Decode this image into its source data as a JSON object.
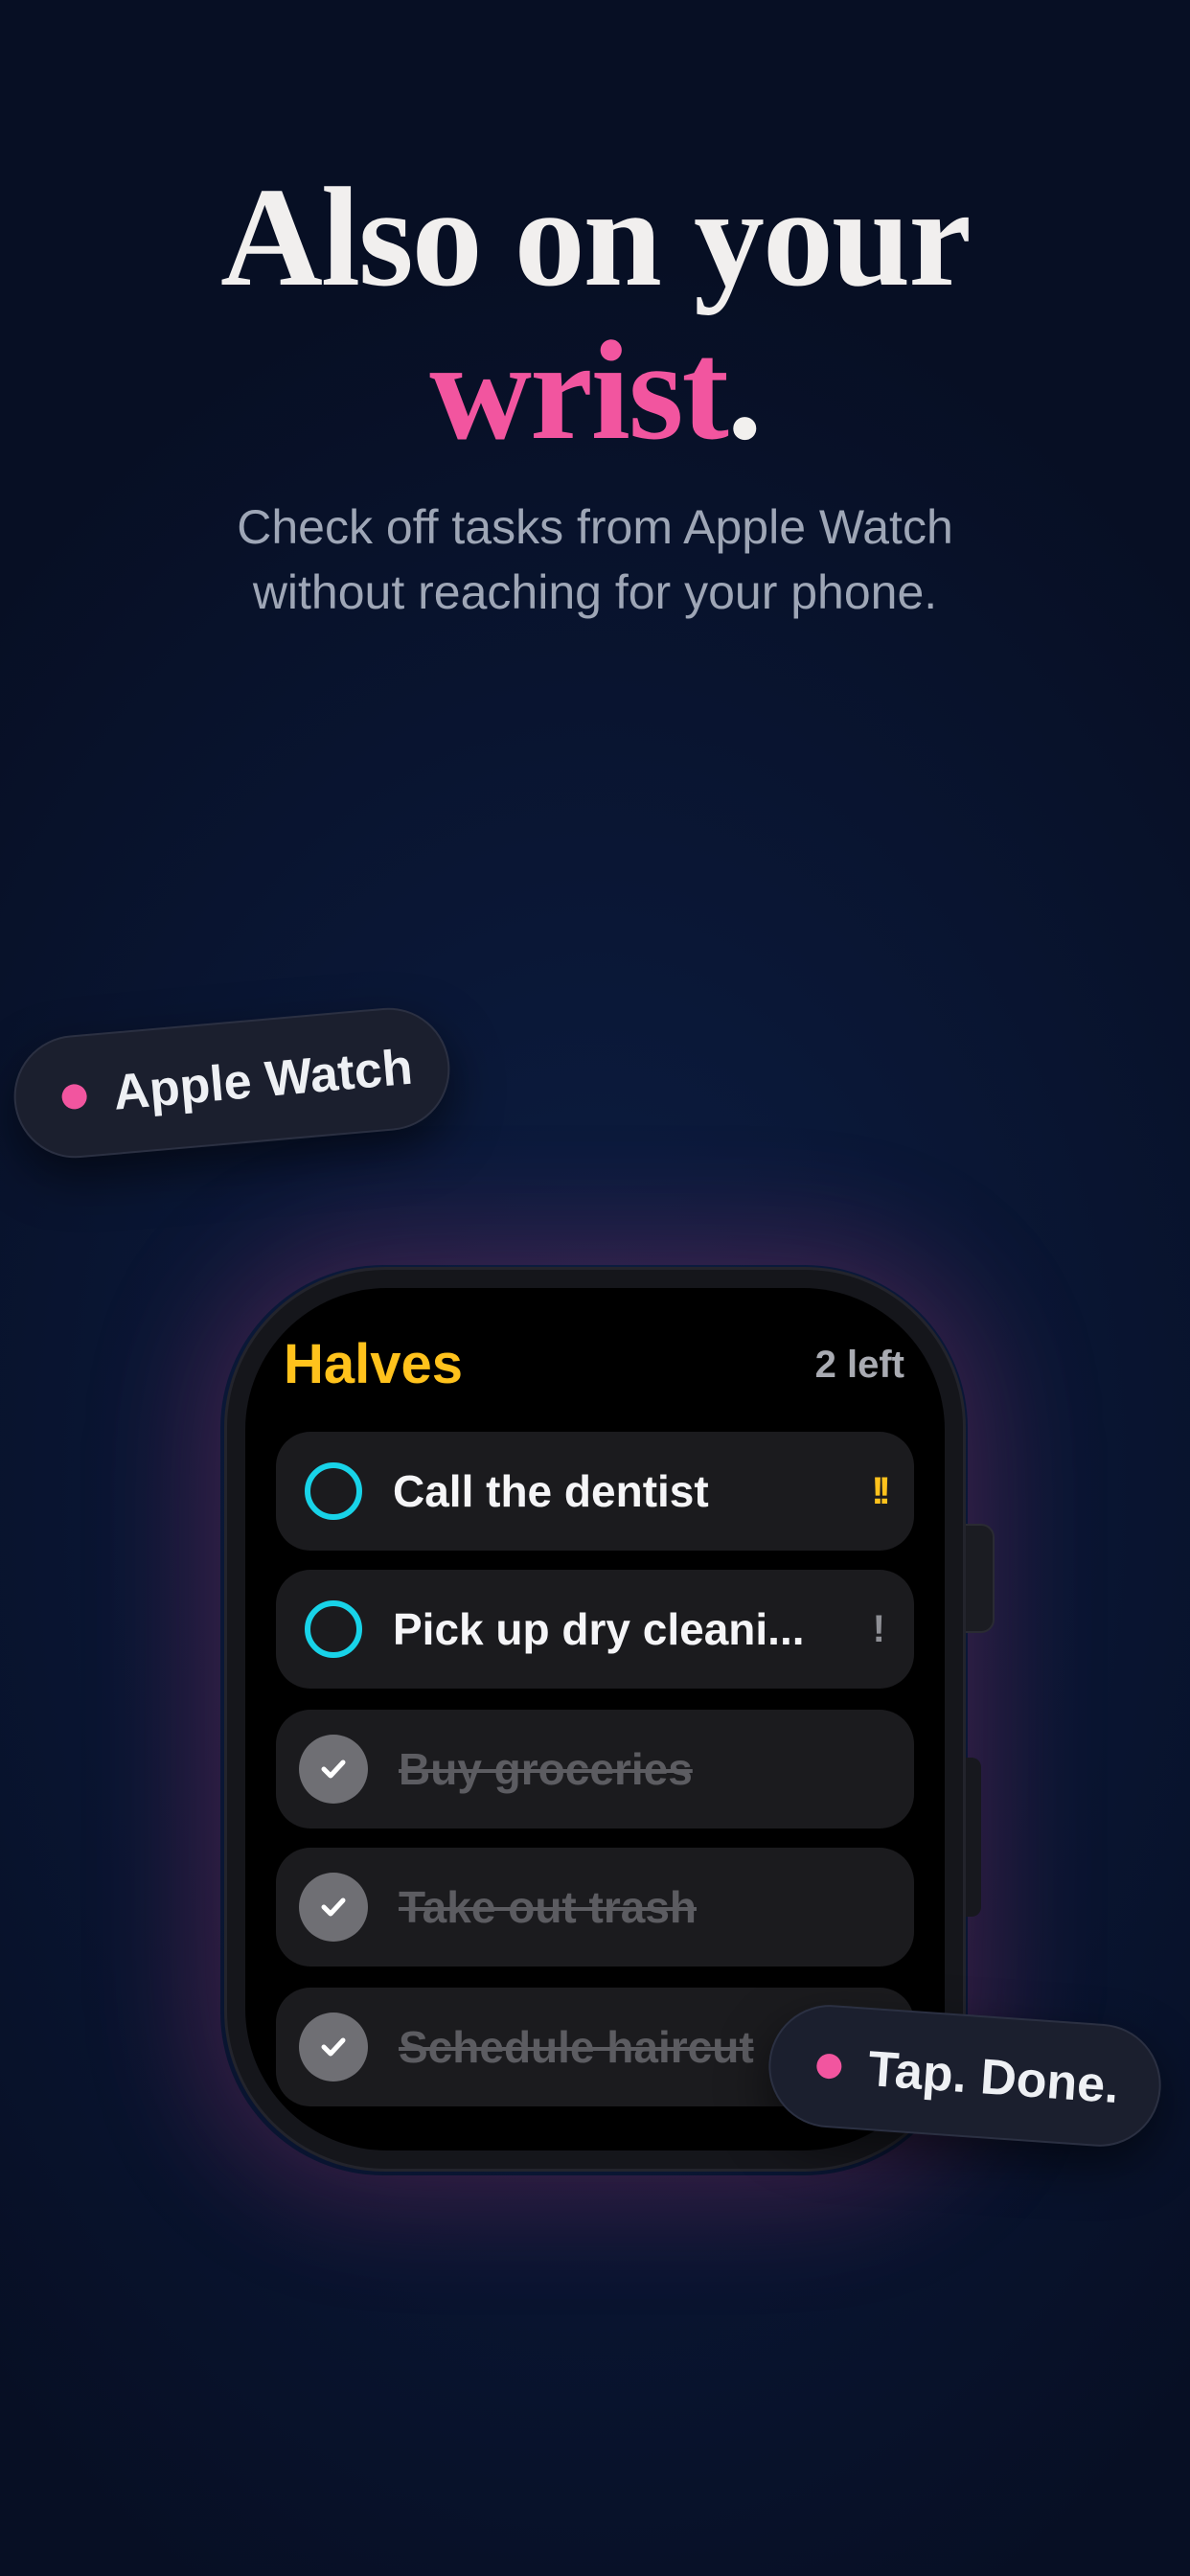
{
  "headline": {
    "line1": "Also on your",
    "accent_word": "wrist",
    "accent_punct": "."
  },
  "subtitle": {
    "line1": "Check off tasks from Apple Watch",
    "line2": "without reaching for your phone."
  },
  "badges": {
    "top": "Apple Watch",
    "bottom": "Tap. Done."
  },
  "watch": {
    "app_title": "Halves",
    "remaining": "2 left",
    "tasks": [
      {
        "label": "Call the dentist",
        "done": false,
        "priority": "!!"
      },
      {
        "label": "Pick up dry cleani...",
        "done": false,
        "priority": "!"
      },
      {
        "label": "Buy groceries",
        "done": true
      },
      {
        "label": "Take out trash",
        "done": true
      },
      {
        "label": "Schedule haircut",
        "done": true
      }
    ]
  },
  "colors": {
    "accent_pink": "#f2559f",
    "title_yellow": "#ffc21c",
    "ring_cyan": "#18d3e8"
  }
}
